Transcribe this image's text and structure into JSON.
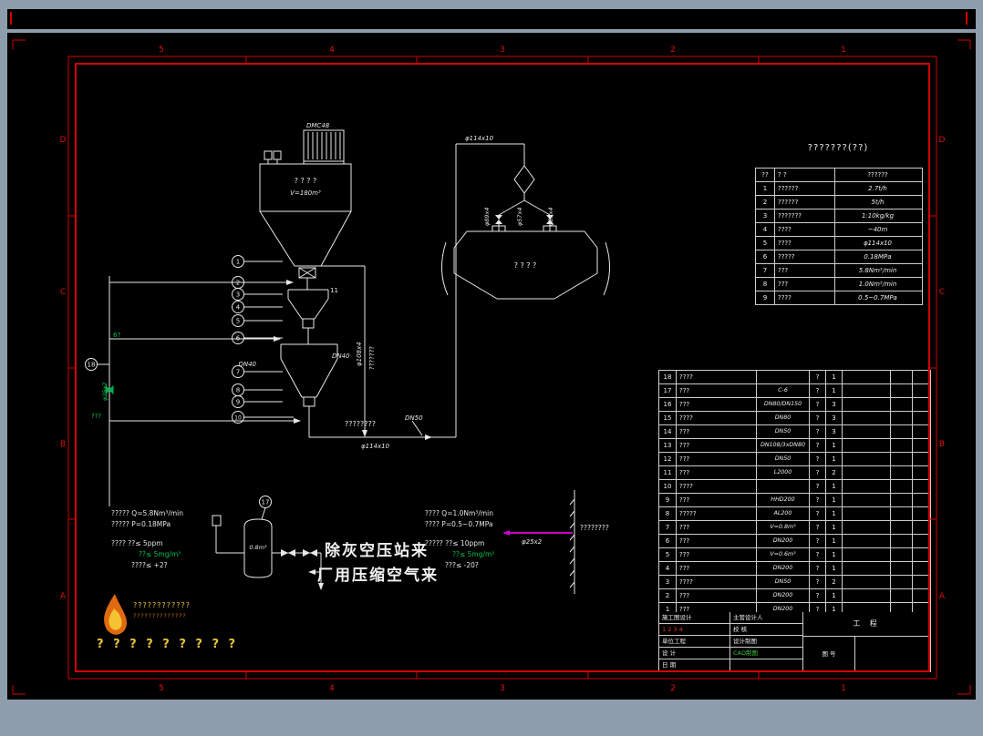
{
  "frame": {
    "zones_top": [
      "5",
      "4",
      "3",
      "2",
      "1"
    ],
    "zones_bottom": [
      "5",
      "4",
      "3",
      "2",
      "1"
    ],
    "zones_side": [
      "D",
      "C",
      "B",
      "A"
    ]
  },
  "drawing": {
    "bag_filter_model": "DMC48",
    "silo_text": "? ? ? ?",
    "silo_volume": "V=180m³",
    "tag11": "11",
    "dn40_right": "DN40",
    "dn40_left": "DN40",
    "dn50": "DN50",
    "note_line": "????????",
    "pipe_phi114_bottom": "φ114x10",
    "pipe_phi114_top": "φ114x10",
    "vert_pipe_phi108": "φ108x4",
    "vert_note": "???????",
    "wagon_text": "? ? ? ?",
    "wagon_v1": "φ89x4",
    "wagon_v2": "φ57x4",
    "wagon_v3": "φ89x4",
    "tank_volume": "0.8m³",
    "phi25": "φ25x2",
    "boundary_note": "????????",
    "green_a": "6?",
    "green_b": "φ25x2",
    "green_c": "???",
    "balloons": [
      "1",
      "2",
      "3",
      "4",
      "5",
      "6",
      "7",
      "8",
      "9",
      "10"
    ],
    "balloon17": "17",
    "balloon18": "18"
  },
  "big_text": {
    "line1": "除灰空压站来",
    "line2": "厂用压缩空气来"
  },
  "ann1": {
    "l1": "????? Q=5.8Nm³/min",
    "l2": "????? P=0.18MPa",
    "l3": "???? ??≤ 5ppm",
    "l4": "??≤ 5mg/m³",
    "l5": "????≤ +2?"
  },
  "ann2": {
    "l1": "???? Q=1.0Nm³/min",
    "l2": "???? P=0.5~0.7MPa",
    "l3": "????? ??≤ 10ppm",
    "l4": "??≤ 5mg/m³",
    "l5": "???≤ -20?"
  },
  "tech_table": {
    "title": "???????(??)",
    "header": [
      "??",
      "?  ?",
      "??????"
    ],
    "rows": [
      [
        "1",
        "??????",
        "2.7t/h"
      ],
      [
        "2",
        "??????",
        "5t/h"
      ],
      [
        "3",
        "???????",
        "1:10kg/kg"
      ],
      [
        "4",
        "????",
        "~40m"
      ],
      [
        "5",
        "????",
        "φ114x10"
      ],
      [
        "6",
        "?????",
        "0.18MPa"
      ],
      [
        "7",
        "???",
        "5.8Nm³/min"
      ],
      [
        "8",
        "???",
        "1.0Nm³/min"
      ],
      [
        "9",
        "????",
        "0.5~0.7MPa"
      ]
    ]
  },
  "bom": {
    "rows": [
      [
        "18",
        "????",
        "",
        "?",
        "1"
      ],
      [
        "17",
        "???",
        "C-6",
        "?",
        "1"
      ],
      [
        "16",
        "???",
        "DN80/DN150",
        "?",
        "3"
      ],
      [
        "15",
        "????",
        "DN80",
        "?",
        "3"
      ],
      [
        "14",
        "???",
        "DN50",
        "?",
        "3"
      ],
      [
        "13",
        "???",
        "DN108/3xDN80",
        "?",
        "1"
      ],
      [
        "12",
        "???",
        "DN50",
        "?",
        "1"
      ],
      [
        "11",
        "???",
        "L2000",
        "?",
        "2"
      ],
      [
        "10",
        "????",
        "",
        "?",
        "1"
      ],
      [
        "9",
        "???",
        "HHD200",
        "?",
        "1"
      ],
      [
        "8",
        "?????",
        "AL200",
        "?",
        "1"
      ],
      [
        "7",
        "???",
        "V=0.8m³",
        "?",
        "1"
      ],
      [
        "6",
        "???",
        "DN200",
        "?",
        "1"
      ],
      [
        "5",
        "???",
        "V=0.6m³",
        "?",
        "1"
      ],
      [
        "4",
        "???",
        "DN200",
        "?",
        "1"
      ],
      [
        "3",
        "????",
        "DN50",
        "?",
        "2"
      ],
      [
        "2",
        "???",
        "DN200",
        "?",
        "1"
      ],
      [
        "1",
        "???",
        "DN200",
        "?",
        "1"
      ]
    ],
    "footer": [
      "??",
      "????",
      "????",
      "??",
      "??",
      "????",
      "?",
      "?"
    ]
  },
  "title_block": {
    "r1l": "施工图设计",
    "r1r": "主管设计人",
    "r2l": "1 2 3 4",
    "r2r": "校 核",
    "r3l": "单位工程",
    "r3r": "设计制图",
    "r4l": "设 计",
    "r4r": "CAD制图",
    "r5l": "日 期",
    "r5r": "",
    "project": "工 程",
    "drawing_no": "图 号"
  },
  "logo": {
    "line1": "????????????",
    "line2": "??????????????",
    "line3": "? ? ? ? ? ? ? ? ?"
  }
}
